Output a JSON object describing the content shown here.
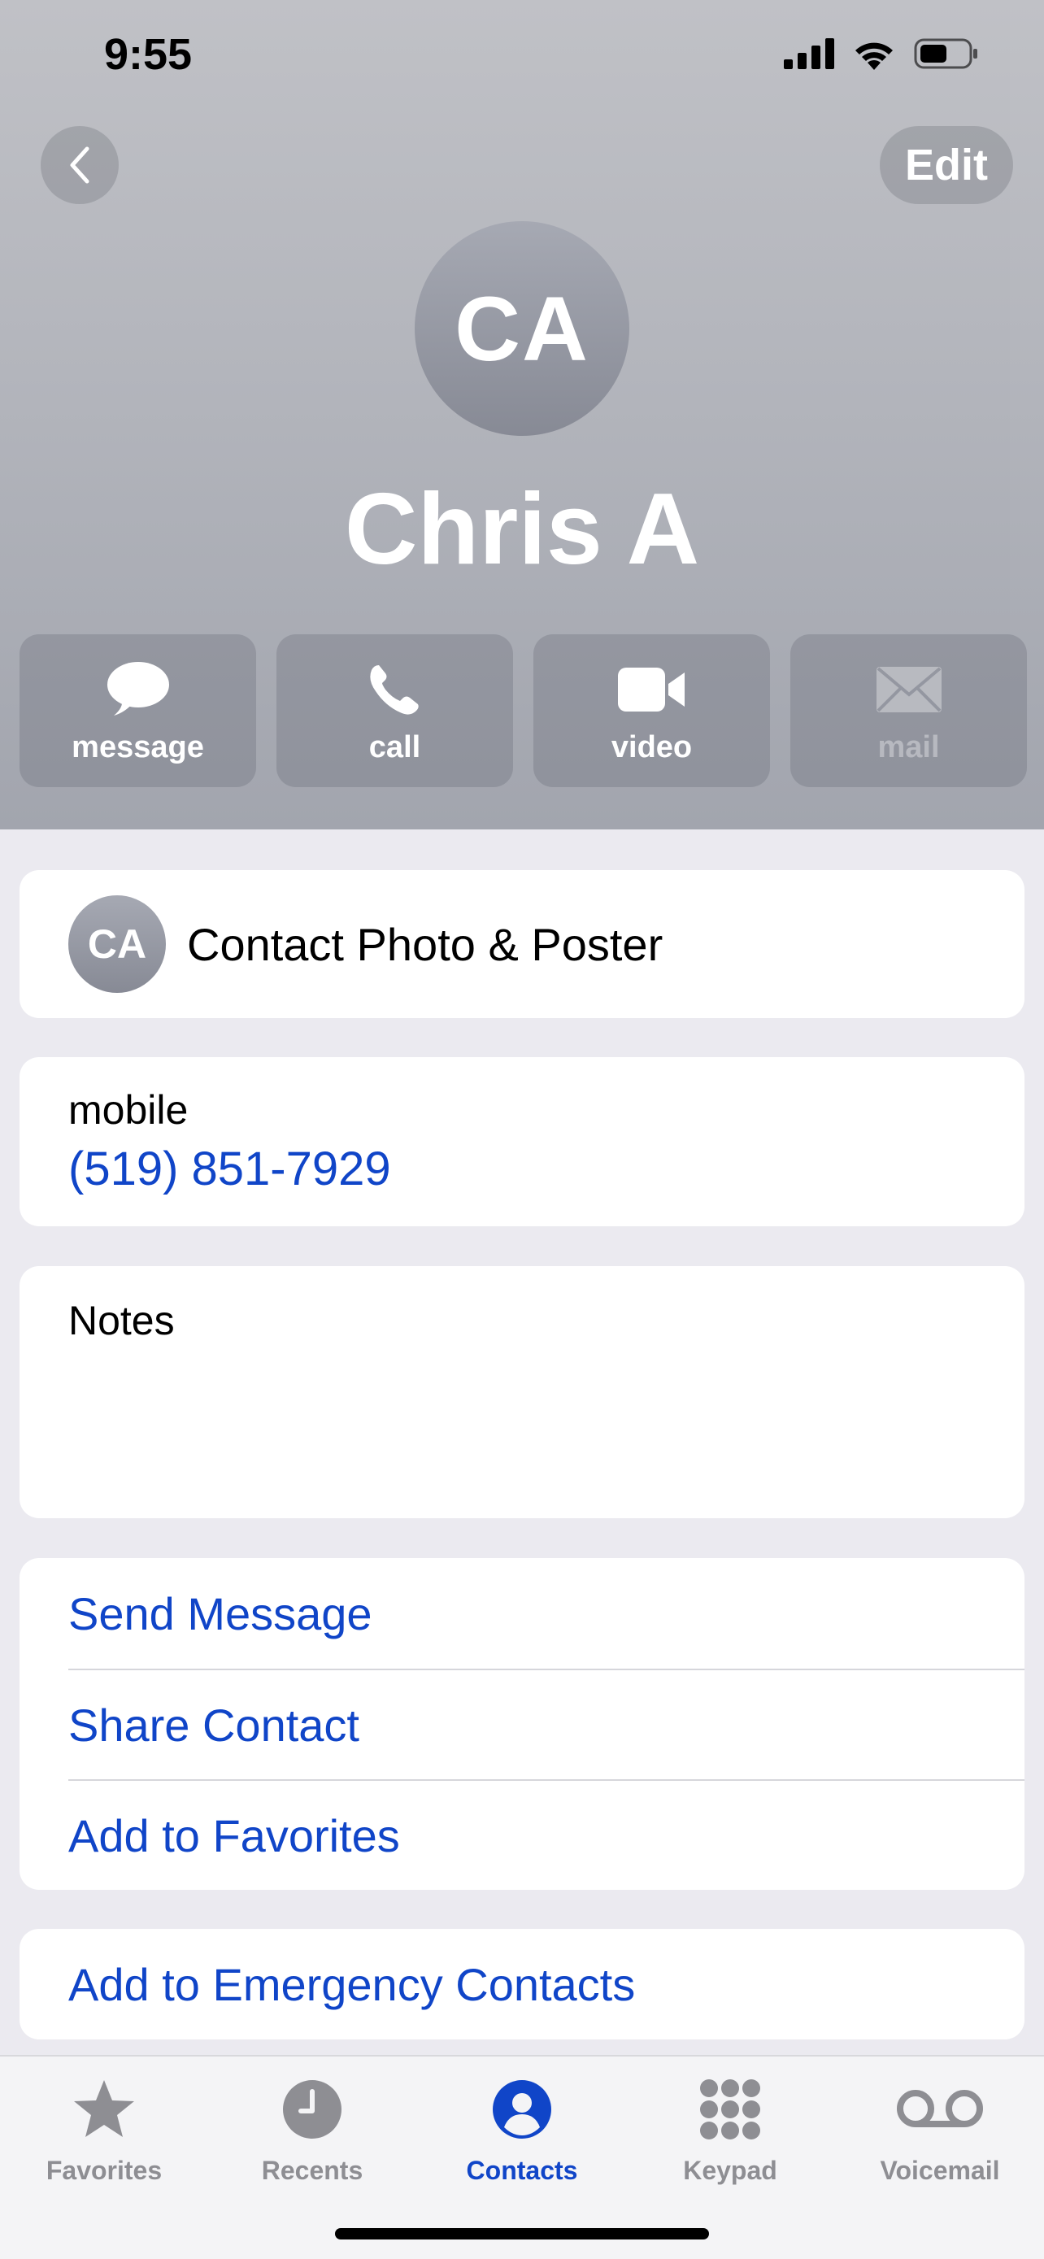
{
  "status_bar": {
    "time": "9:55"
  },
  "nav": {
    "edit_label": "Edit"
  },
  "contact": {
    "initials": "CA",
    "name": "Chris A"
  },
  "actions": [
    {
      "label": "message",
      "icon": "message-icon",
      "enabled": true
    },
    {
      "label": "call",
      "icon": "phone-icon",
      "enabled": true
    },
    {
      "label": "video",
      "icon": "video-icon",
      "enabled": true
    },
    {
      "label": "mail",
      "icon": "mail-icon",
      "enabled": false
    }
  ],
  "photo_poster": {
    "initials": "CA",
    "label": "Contact Photo & Poster"
  },
  "phone": {
    "label": "mobile",
    "value": "(519) 851-7929"
  },
  "notes": {
    "label": "Notes"
  },
  "links": [
    "Send Message",
    "Share Contact",
    "Add to Favorites"
  ],
  "emergency": {
    "label": "Add to Emergency Contacts"
  },
  "tabs": [
    {
      "label": "Favorites",
      "icon": "star-icon"
    },
    {
      "label": "Recents",
      "icon": "clock-icon"
    },
    {
      "label": "Contacts",
      "icon": "person-circle-icon",
      "active": true
    },
    {
      "label": "Keypad",
      "icon": "keypad-icon"
    },
    {
      "label": "Voicemail",
      "icon": "voicemail-icon"
    }
  ],
  "colors": {
    "link": "#1045c8",
    "tab_inactive": "#8e8e93",
    "background": "#ebeaf0"
  }
}
